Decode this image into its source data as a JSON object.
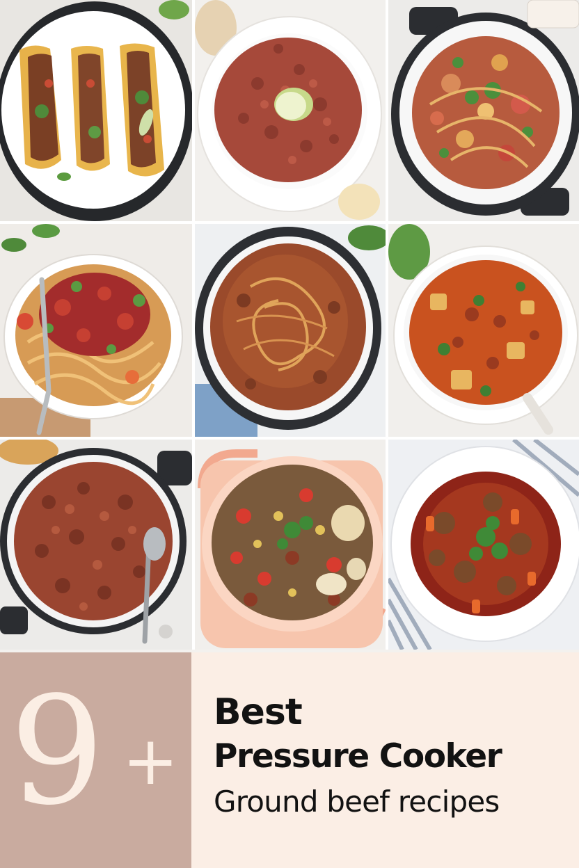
{
  "photos": [
    {
      "dish": "tacos"
    },
    {
      "dish": "ground beef with lime"
    },
    {
      "dish": "vegetable noodle stew"
    },
    {
      "dish": "spaghetti with meat sauce"
    },
    {
      "dish": "noodles in sauce"
    },
    {
      "dish": "tomato stew"
    },
    {
      "dish": "ground beef"
    },
    {
      "dish": "vegetable beef stew"
    },
    {
      "dish": "beef stew with carrots"
    }
  ],
  "headline": {
    "number": "9",
    "plus": "+",
    "line1": "Best",
    "line2": "Pressure Cooker",
    "line3": "Ground beef recipes"
  },
  "colors": {
    "number_panel": "#c9ab9f",
    "text_panel": "#fbeee5",
    "number_text": "#fbeee4",
    "headline_text": "#121212"
  }
}
